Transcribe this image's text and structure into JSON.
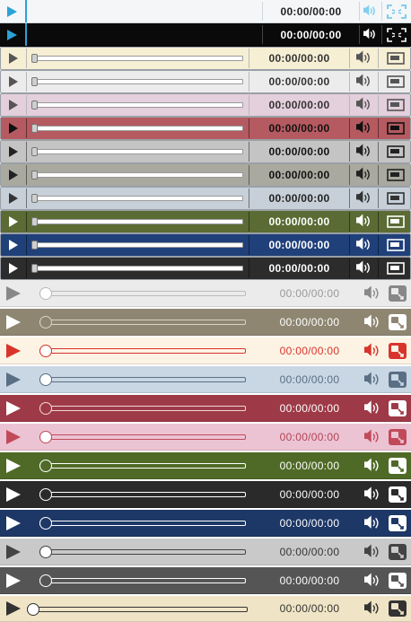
{
  "players": [
    {
      "id": "p1",
      "time": "00:00/00:00",
      "style": "A",
      "bg": "#f4f6f8",
      "timeColor": "#222222",
      "accent": "#2aa2d8"
    },
    {
      "id": "p2",
      "time": "00:00/00:00",
      "style": "A",
      "bg": "#0a0a0a",
      "timeColor": "#ffffff",
      "accent": "#2aa2d8"
    },
    {
      "id": "p3",
      "time": "00:00/00:00",
      "style": "B",
      "bg": "#f6efd4",
      "timeColor": "#333333",
      "iconColor": "#555555"
    },
    {
      "id": "p4",
      "time": "00:00/00:00",
      "style": "B",
      "bg": "#ececec",
      "timeColor": "#333333",
      "iconColor": "#555555"
    },
    {
      "id": "p5",
      "time": "00:00/00:00",
      "style": "B",
      "bg": "#e4cfdc",
      "timeColor": "#333333",
      "iconColor": "#555555"
    },
    {
      "id": "p6",
      "time": "00:00/00:00",
      "style": "B",
      "bg": "#b55a60",
      "timeColor": "#111111",
      "iconColor": "#111111"
    },
    {
      "id": "p7",
      "time": "00:00/00:00",
      "style": "B",
      "bg": "#c4c4c4",
      "timeColor": "#111111",
      "iconColor": "#222222"
    },
    {
      "id": "p8",
      "time": "00:00/00:00",
      "style": "B",
      "bg": "#a9a99f",
      "timeColor": "#111111",
      "iconColor": "#222222"
    },
    {
      "id": "p9",
      "time": "00:00/00:00",
      "style": "B",
      "bg": "#c7d0d8",
      "timeColor": "#222222",
      "iconColor": "#333333"
    },
    {
      "id": "p10",
      "time": "00:00/00:00",
      "style": "B",
      "bg": "#5a6b34",
      "timeColor": "#ffffff",
      "iconColor": "#ffffff"
    },
    {
      "id": "p11",
      "time": "00:00/00:00",
      "style": "B",
      "bg": "#20407a",
      "timeColor": "#ffffff",
      "iconColor": "#ffffff"
    },
    {
      "id": "p12",
      "time": "00:00/00:00",
      "style": "B",
      "bg": "#2c2c2c",
      "timeColor": "#ffffff",
      "iconColor": "#ffffff"
    },
    {
      "id": "p13",
      "time": "00:00/00:00",
      "style": "C",
      "bg": "#ebebeb",
      "timeColor": "#999999",
      "iconColor": "#888888",
      "trackColor": "#bbbbbb",
      "knobFill": "#ffffff"
    },
    {
      "id": "p14",
      "time": "00:00/00:00",
      "style": "C",
      "bg": "#8f8672",
      "timeColor": "#ffffff",
      "iconColor": "#ffffff",
      "trackColor": "#d8d2c2",
      "knobFill": "#8f8672"
    },
    {
      "id": "p15",
      "time": "00:00/00:00",
      "style": "C",
      "bg": "#fdf3e4",
      "timeColor": "#d9342b",
      "iconColor": "#d9342b",
      "trackColor": "#d9342b",
      "knobFill": "#ffffff"
    },
    {
      "id": "p16",
      "time": "00:00/00:00",
      "style": "C",
      "bg": "#c9d7e4",
      "timeColor": "#5a6e84",
      "iconColor": "#5a6e84",
      "trackColor": "#5a6e84",
      "knobFill": "#ffffff"
    },
    {
      "id": "p17",
      "time": "00:00/00:00",
      "style": "C",
      "bg": "#9e3a47",
      "timeColor": "#ffffff",
      "iconColor": "#ffffff",
      "trackColor": "#f2d6da",
      "knobFill": "#9e3a47"
    },
    {
      "id": "p18",
      "time": "00:00/00:00",
      "style": "C",
      "bg": "#ecc3d3",
      "timeColor": "#b24455",
      "iconColor": "#c14a5a",
      "trackColor": "#c14a5a",
      "knobFill": "#ffffff"
    },
    {
      "id": "p19",
      "time": "00:00/00:00",
      "style": "C",
      "bg": "#4f6a26",
      "timeColor": "#ffffff",
      "iconColor": "#ffffff",
      "trackColor": "#ffffff",
      "knobFill": "#4f6a26"
    },
    {
      "id": "p20",
      "time": "00:00/00:00",
      "style": "C",
      "bg": "#2a2a2a",
      "timeColor": "#ffffff",
      "iconColor": "#ffffff",
      "trackColor": "#ffffff",
      "knobFill": "#2a2a2a"
    },
    {
      "id": "p21",
      "time": "00:00/00:00",
      "style": "C",
      "bg": "#1d3766",
      "timeColor": "#ffffff",
      "iconColor": "#ffffff",
      "trackColor": "#ffffff",
      "knobFill": "#1d3766"
    },
    {
      "id": "p22",
      "time": "00:00/00:00",
      "style": "C",
      "bg": "#c9c9c9",
      "timeColor": "#333333",
      "iconColor": "#444444",
      "trackColor": "#444444",
      "knobFill": "#ffffff"
    },
    {
      "id": "p23",
      "time": "00:00/00:00",
      "style": "C",
      "bg": "#555555",
      "timeColor": "#ffffff",
      "iconColor": "#ffffff",
      "trackColor": "#ffffff",
      "knobFill": "#555555"
    },
    {
      "id": "p24",
      "time": "00:00/00:00",
      "style": "D",
      "bg": "#efe4c5",
      "timeColor": "#333333",
      "iconColor": "#333333",
      "trackColor": "#333333",
      "knobFill": "#ffffff"
    }
  ]
}
